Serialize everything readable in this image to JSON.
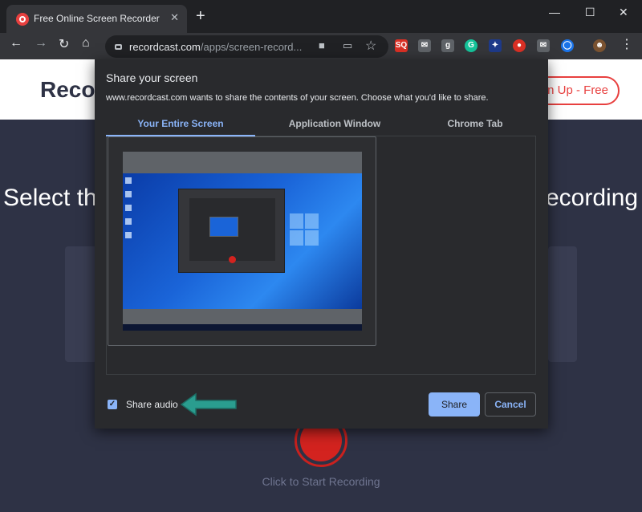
{
  "browser": {
    "tab_title": "Free Online Screen Recorder - Re",
    "tab_close": "✕",
    "new_tab": "+",
    "minimize": "—",
    "maximize": "☐",
    "close": "✕",
    "back": "←",
    "forward": "→",
    "reload": "↻",
    "home": "⌂",
    "url_host": "recordcast.com",
    "url_path": "/apps/screen-record...",
    "omnibox_icons": {
      "camera": "■",
      "cast": "▭",
      "star": "☆"
    },
    "extensions": [
      "SQ",
      "✉",
      "g",
      "G",
      "✦",
      "●",
      "✉",
      "◯",
      "☻"
    ],
    "menu": "⋮"
  },
  "page": {
    "logo": "Reco",
    "signup": "gn Up - Free",
    "headline_left": "Select th",
    "headline_right": "ecording",
    "start_recording": "Click to Start Recording"
  },
  "dialog": {
    "title": "Share your screen",
    "description": "www.recordcast.com wants to share the contents of your screen. Choose what you'd like to share.",
    "tabs": [
      {
        "label": "Your Entire Screen",
        "active": true
      },
      {
        "label": "Application Window",
        "active": false
      },
      {
        "label": "Chrome Tab",
        "active": false
      }
    ],
    "share_audio_label": "Share audio",
    "share_audio_checked": true,
    "share_button": "Share",
    "cancel_button": "Cancel"
  },
  "colors": {
    "accent": "#8ab4f8",
    "brand_red": "#e8403f",
    "arrow_teal": "#2a9d8f"
  }
}
